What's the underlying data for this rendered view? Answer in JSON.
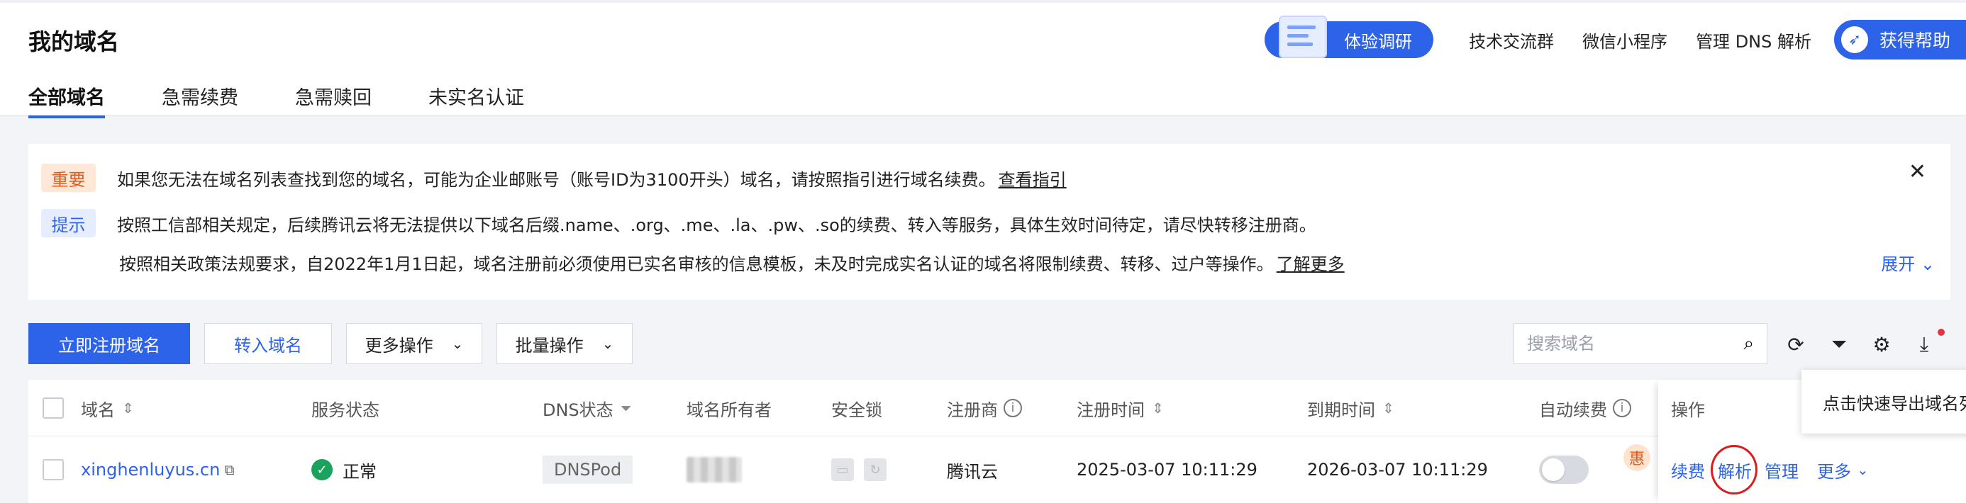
{
  "page": {
    "title": "我的域名"
  },
  "header": {
    "survey_label": "体验调研",
    "links": [
      "技术交流群",
      "微信小程序",
      "管理 DNS 解析"
    ],
    "help_label": "获得帮助"
  },
  "tabs": [
    {
      "label": "全部域名",
      "active": true
    },
    {
      "label": "急需续费",
      "active": false
    },
    {
      "label": "急需赎回",
      "active": false
    },
    {
      "label": "未实名认证",
      "active": false
    }
  ],
  "notice": {
    "important_tag": "重要",
    "important_text": "如果您无法在域名列表查找到您的域名，可能为企业邮账号（账号ID为3100开头）域名，请按照指引进行域名续费。",
    "important_link": "查看指引",
    "tip_tag": "提示",
    "tip_text": "按照工信部相关规定，后续腾讯云将无法提供以下域名后缀.name、.org、.me、.la、.pw、.so的续费、转入等服务，具体生效时间待定，请尽快转移注册商。",
    "policy_text": "按照相关政策法规要求，自2022年1月1日起，域名注册前必须使用已实名审核的信息模板，未及时完成实名认证的域名将限制续费、转移、过户等操作。",
    "policy_link": "了解更多",
    "expand_label": "展开"
  },
  "toolbar": {
    "register_label": "立即注册域名",
    "transfer_label": "转入域名",
    "more_ops_label": "更多操作",
    "batch_ops_label": "批量操作",
    "search_placeholder": "搜索域名"
  },
  "table": {
    "columns": {
      "domain": "域名",
      "service_status": "服务状态",
      "dns_status": "DNS状态",
      "owner": "域名所有者",
      "security_lock": "安全锁",
      "registrar": "注册商",
      "reg_time": "注册时间",
      "expire_time": "到期时间",
      "auto_renew": "自动续费",
      "actions": "操作"
    },
    "rows": [
      {
        "domain": "xinghenluyus.cn",
        "status": "正常",
        "dns": "DNSPod",
        "registrar": "腾讯云",
        "reg_time": "2025-03-07 10:11:29",
        "expire_time": "2026-03-07 10:11:29",
        "auto_renew_badge": "惠",
        "actions": {
          "renew": "续费",
          "resolve": "解析",
          "manage": "管理",
          "more": "更多"
        }
      }
    ]
  },
  "tooltip": {
    "text": "点击快速导出域名列表"
  },
  "colors": {
    "primary": "#2d63e8",
    "success": "#1aa35c",
    "warning": "#e05a1a",
    "highlight_circle": "#d81e1e"
  }
}
